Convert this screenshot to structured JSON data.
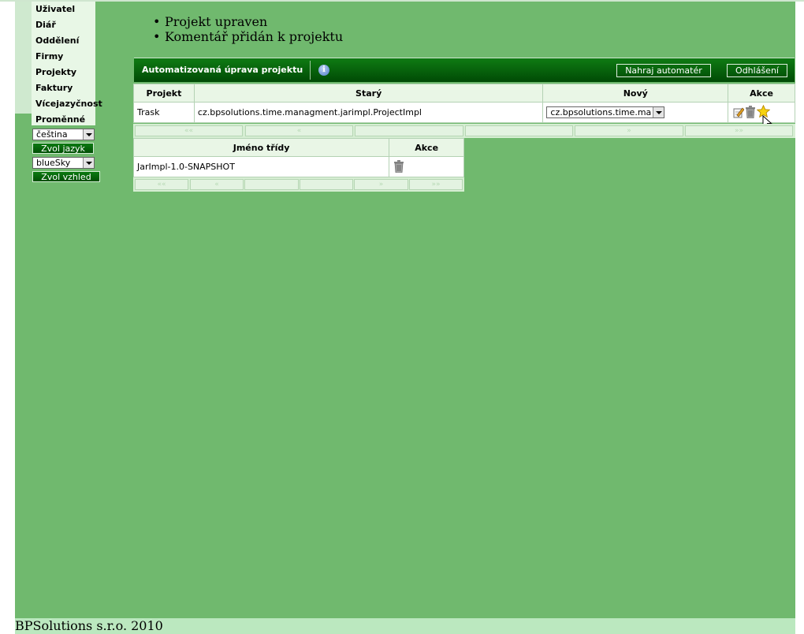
{
  "nav": {
    "items": [
      "Uživatel",
      "Diář",
      "Oddělení",
      "Firmy",
      "Projekty",
      "Faktury",
      "Vícejazyčnost",
      "Proměnné"
    ],
    "language_select": "čeština",
    "language_button": "Zvol jazyk",
    "skin_select": "blueSky",
    "skin_button": "Zvol vzhled"
  },
  "messages": [
    "Projekt upraven",
    "Komentář přidán k projektu"
  ],
  "panel": {
    "title": "Automatizovaná úprava projektu",
    "upload_button": "Nahraj automatér",
    "logout_button": "Odhlášení"
  },
  "main_table": {
    "headers": [
      "Projekt",
      "Starý",
      "Nový",
      "Akce"
    ],
    "rows": [
      {
        "project": "Trask",
        "old": "cz.bpsolutions.time.managment.jarimpl.ProjectImpl",
        "new": "cz.bpsolutions.time.managment.jarimpl.ProjectImpl"
      }
    ]
  },
  "class_table": {
    "headers": [
      "Jméno třídy",
      "Akce"
    ],
    "rows": [
      {
        "name": "JarImpl-1.0-SNAPSHOT"
      }
    ]
  },
  "pager_labels": [
    "««",
    "«",
    "",
    "",
    "»",
    "»»"
  ],
  "footer": "BPSolutions s.r.o. 2010",
  "colors": {
    "page_bg": "#70b96e",
    "header_green": "#004a05",
    "footer_bg": "#bbe8bf"
  }
}
